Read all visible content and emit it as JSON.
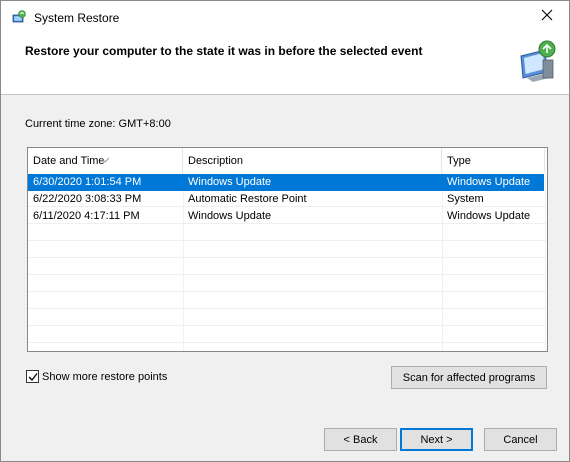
{
  "window": {
    "title": "System Restore",
    "close_icon": "close-icon",
    "app_icon": "system-restore-icon"
  },
  "header": {
    "title": "Restore your computer to the state it was in before the selected event",
    "icon": "monitor-restore-icon"
  },
  "timezone_label": "Current time zone: GMT+8:00",
  "table": {
    "columns": [
      "Date and Time",
      "Description",
      "Type"
    ],
    "sorted_column": "Date and Time",
    "rows": [
      {
        "date": "6/30/2020 1:01:54 PM",
        "description": "Windows Update",
        "type": "Windows Update",
        "selected": true
      },
      {
        "date": "6/22/2020 3:08:33 PM",
        "description": "Automatic Restore Point",
        "type": "System",
        "selected": false
      },
      {
        "date": "6/11/2020 4:17:11 PM",
        "description": "Windows Update",
        "type": "Windows Update",
        "selected": false
      }
    ]
  },
  "show_more": {
    "label": "Show more restore points",
    "checked": true
  },
  "buttons": {
    "scan": "Scan for affected programs",
    "back": "< Back",
    "next": "Next >",
    "cancel": "Cancel"
  },
  "colors": {
    "selection": "#0078d7",
    "default_button_border": "#0078d7"
  }
}
